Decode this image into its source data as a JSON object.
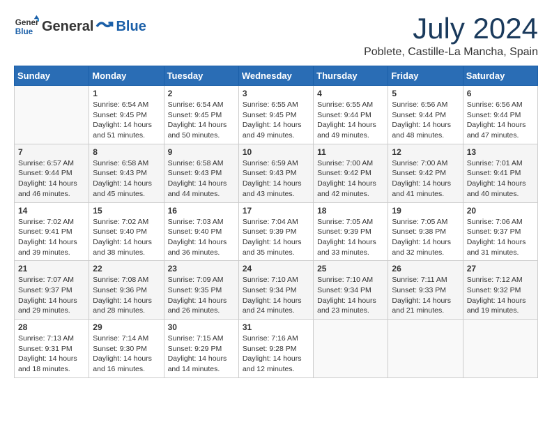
{
  "logo": {
    "general": "General",
    "blue": "Blue"
  },
  "header": {
    "month": "July 2024",
    "location": "Poblete, Castille-La Mancha, Spain"
  },
  "weekdays": [
    "Sunday",
    "Monday",
    "Tuesday",
    "Wednesday",
    "Thursday",
    "Friday",
    "Saturday"
  ],
  "weeks": [
    [
      {
        "day": "",
        "sunrise": "",
        "sunset": "",
        "daylight": ""
      },
      {
        "day": "1",
        "sunrise": "Sunrise: 6:54 AM",
        "sunset": "Sunset: 9:45 PM",
        "daylight": "Daylight: 14 hours and 51 minutes."
      },
      {
        "day": "2",
        "sunrise": "Sunrise: 6:54 AM",
        "sunset": "Sunset: 9:45 PM",
        "daylight": "Daylight: 14 hours and 50 minutes."
      },
      {
        "day": "3",
        "sunrise": "Sunrise: 6:55 AM",
        "sunset": "Sunset: 9:45 PM",
        "daylight": "Daylight: 14 hours and 49 minutes."
      },
      {
        "day": "4",
        "sunrise": "Sunrise: 6:55 AM",
        "sunset": "Sunset: 9:44 PM",
        "daylight": "Daylight: 14 hours and 49 minutes."
      },
      {
        "day": "5",
        "sunrise": "Sunrise: 6:56 AM",
        "sunset": "Sunset: 9:44 PM",
        "daylight": "Daylight: 14 hours and 48 minutes."
      },
      {
        "day": "6",
        "sunrise": "Sunrise: 6:56 AM",
        "sunset": "Sunset: 9:44 PM",
        "daylight": "Daylight: 14 hours and 47 minutes."
      }
    ],
    [
      {
        "day": "7",
        "sunrise": "Sunrise: 6:57 AM",
        "sunset": "Sunset: 9:44 PM",
        "daylight": "Daylight: 14 hours and 46 minutes."
      },
      {
        "day": "8",
        "sunrise": "Sunrise: 6:58 AM",
        "sunset": "Sunset: 9:43 PM",
        "daylight": "Daylight: 14 hours and 45 minutes."
      },
      {
        "day": "9",
        "sunrise": "Sunrise: 6:58 AM",
        "sunset": "Sunset: 9:43 PM",
        "daylight": "Daylight: 14 hours and 44 minutes."
      },
      {
        "day": "10",
        "sunrise": "Sunrise: 6:59 AM",
        "sunset": "Sunset: 9:43 PM",
        "daylight": "Daylight: 14 hours and 43 minutes."
      },
      {
        "day": "11",
        "sunrise": "Sunrise: 7:00 AM",
        "sunset": "Sunset: 9:42 PM",
        "daylight": "Daylight: 14 hours and 42 minutes."
      },
      {
        "day": "12",
        "sunrise": "Sunrise: 7:00 AM",
        "sunset": "Sunset: 9:42 PM",
        "daylight": "Daylight: 14 hours and 41 minutes."
      },
      {
        "day": "13",
        "sunrise": "Sunrise: 7:01 AM",
        "sunset": "Sunset: 9:41 PM",
        "daylight": "Daylight: 14 hours and 40 minutes."
      }
    ],
    [
      {
        "day": "14",
        "sunrise": "Sunrise: 7:02 AM",
        "sunset": "Sunset: 9:41 PM",
        "daylight": "Daylight: 14 hours and 39 minutes."
      },
      {
        "day": "15",
        "sunrise": "Sunrise: 7:02 AM",
        "sunset": "Sunset: 9:40 PM",
        "daylight": "Daylight: 14 hours and 38 minutes."
      },
      {
        "day": "16",
        "sunrise": "Sunrise: 7:03 AM",
        "sunset": "Sunset: 9:40 PM",
        "daylight": "Daylight: 14 hours and 36 minutes."
      },
      {
        "day": "17",
        "sunrise": "Sunrise: 7:04 AM",
        "sunset": "Sunset: 9:39 PM",
        "daylight": "Daylight: 14 hours and 35 minutes."
      },
      {
        "day": "18",
        "sunrise": "Sunrise: 7:05 AM",
        "sunset": "Sunset: 9:39 PM",
        "daylight": "Daylight: 14 hours and 33 minutes."
      },
      {
        "day": "19",
        "sunrise": "Sunrise: 7:05 AM",
        "sunset": "Sunset: 9:38 PM",
        "daylight": "Daylight: 14 hours and 32 minutes."
      },
      {
        "day": "20",
        "sunrise": "Sunrise: 7:06 AM",
        "sunset": "Sunset: 9:37 PM",
        "daylight": "Daylight: 14 hours and 31 minutes."
      }
    ],
    [
      {
        "day": "21",
        "sunrise": "Sunrise: 7:07 AM",
        "sunset": "Sunset: 9:37 PM",
        "daylight": "Daylight: 14 hours and 29 minutes."
      },
      {
        "day": "22",
        "sunrise": "Sunrise: 7:08 AM",
        "sunset": "Sunset: 9:36 PM",
        "daylight": "Daylight: 14 hours and 28 minutes."
      },
      {
        "day": "23",
        "sunrise": "Sunrise: 7:09 AM",
        "sunset": "Sunset: 9:35 PM",
        "daylight": "Daylight: 14 hours and 26 minutes."
      },
      {
        "day": "24",
        "sunrise": "Sunrise: 7:10 AM",
        "sunset": "Sunset: 9:34 PM",
        "daylight": "Daylight: 14 hours and 24 minutes."
      },
      {
        "day": "25",
        "sunrise": "Sunrise: 7:10 AM",
        "sunset": "Sunset: 9:34 PM",
        "daylight": "Daylight: 14 hours and 23 minutes."
      },
      {
        "day": "26",
        "sunrise": "Sunrise: 7:11 AM",
        "sunset": "Sunset: 9:33 PM",
        "daylight": "Daylight: 14 hours and 21 minutes."
      },
      {
        "day": "27",
        "sunrise": "Sunrise: 7:12 AM",
        "sunset": "Sunset: 9:32 PM",
        "daylight": "Daylight: 14 hours and 19 minutes."
      }
    ],
    [
      {
        "day": "28",
        "sunrise": "Sunrise: 7:13 AM",
        "sunset": "Sunset: 9:31 PM",
        "daylight": "Daylight: 14 hours and 18 minutes."
      },
      {
        "day": "29",
        "sunrise": "Sunrise: 7:14 AM",
        "sunset": "Sunset: 9:30 PM",
        "daylight": "Daylight: 14 hours and 16 minutes."
      },
      {
        "day": "30",
        "sunrise": "Sunrise: 7:15 AM",
        "sunset": "Sunset: 9:29 PM",
        "daylight": "Daylight: 14 hours and 14 minutes."
      },
      {
        "day": "31",
        "sunrise": "Sunrise: 7:16 AM",
        "sunset": "Sunset: 9:28 PM",
        "daylight": "Daylight: 14 hours and 12 minutes."
      },
      {
        "day": "",
        "sunrise": "",
        "sunset": "",
        "daylight": ""
      },
      {
        "day": "",
        "sunrise": "",
        "sunset": "",
        "daylight": ""
      },
      {
        "day": "",
        "sunrise": "",
        "sunset": "",
        "daylight": ""
      }
    ]
  ]
}
